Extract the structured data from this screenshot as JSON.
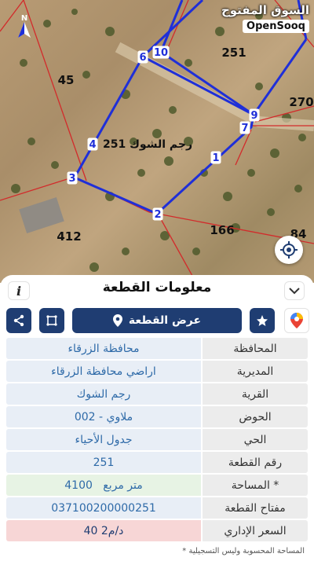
{
  "map": {
    "parcel_labels": [
      "251",
      "45",
      "412",
      "166",
      "84",
      "270"
    ],
    "center_label": "رجم الشوك 251",
    "vertex_numbers": [
      "1",
      "2",
      "3",
      "4",
      "6",
      "7",
      "9",
      "10"
    ],
    "north_icon": "north-arrow-icon",
    "locate_icon": "crosshair-icon",
    "colors": {
      "boundary": "#1f2fd8",
      "neighbor_lines": "#d22b2b"
    }
  },
  "brand": {
    "arabic": "السوق المفتوح",
    "english": "OpenSooq"
  },
  "panel": {
    "title": "معلومات القطعة",
    "info_label": "i",
    "view_parcel_label": "عرض القطعة",
    "icons": [
      "share-icon",
      "polygon-icon",
      "location-pin-icon",
      "bookmark-icon",
      "google-maps-icon",
      "chevron-down-icon"
    ],
    "accent_color": "#1f3d72"
  },
  "rows": [
    {
      "label": "المحافظة",
      "value": "محافظة الزرقاء"
    },
    {
      "label": "المديرية",
      "value": "اراضي محافظة الزرقاء"
    },
    {
      "label": "القرية",
      "value": "رجم الشوك"
    },
    {
      "label": "الحوض",
      "value": "ملاوي - 002"
    },
    {
      "label": "الحي",
      "value": "جدول الأحياء"
    },
    {
      "label": "رقم القطعة",
      "value": "251"
    },
    {
      "label": "المساحة *",
      "value": "4100   متر مربع"
    },
    {
      "label": "مفتاح القطعة",
      "value": "037100200000251"
    },
    {
      "label": "السعر الإداري",
      "value": "40 د/م2"
    }
  ],
  "footnote": "* المساحة المحسوبة وليس التسجيلية"
}
